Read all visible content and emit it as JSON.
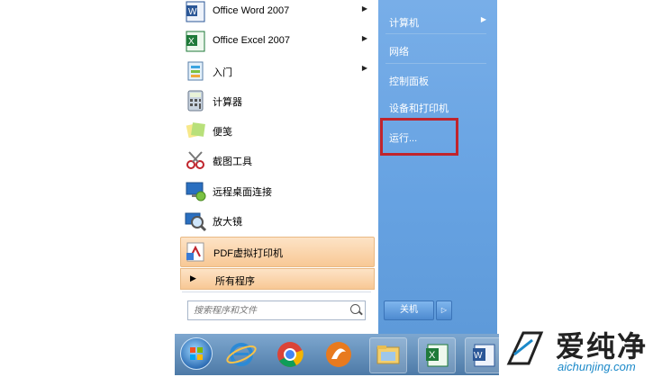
{
  "left_items": [
    {
      "label": "Office Word 2007",
      "icon": "word-icon",
      "arrow": true
    },
    {
      "label": "Office Excel 2007",
      "icon": "excel-icon",
      "arrow": true
    },
    {
      "label": "入门",
      "icon": "getting-started-icon",
      "arrow": true
    },
    {
      "label": "计算器",
      "icon": "calculator-icon",
      "arrow": false
    },
    {
      "label": "便笺",
      "icon": "sticky-notes-icon",
      "arrow": false
    },
    {
      "label": "截图工具",
      "icon": "snipping-tool-icon",
      "arrow": false
    },
    {
      "label": "远程桌面连接",
      "icon": "remote-desktop-icon",
      "arrow": false
    },
    {
      "label": "放大镜",
      "icon": "magnifier-icon",
      "arrow": false
    },
    {
      "label": "PDF虚拟打印机",
      "icon": "pdf-printer-icon",
      "arrow": false
    }
  ],
  "all_programs": "所有程序",
  "search": {
    "placeholder": "搜索程序和文件"
  },
  "right_items": [
    {
      "label": "计算机",
      "arrow": true
    },
    {
      "label": "网络",
      "arrow": false
    },
    {
      "label": "控制面板",
      "arrow": false
    },
    {
      "label": "设备和打印机",
      "arrow": false
    },
    {
      "label": "运行...",
      "arrow": false
    }
  ],
  "shutdown": {
    "label": "关机",
    "arrow": "▷"
  },
  "taskbar": [
    "windows-start-icon",
    "internet-explorer-icon",
    "chrome-icon",
    "media-app-icon",
    "file-explorer-icon",
    "excel-taskbar-icon",
    "word-taskbar-icon"
  ],
  "watermark": {
    "text": "爱纯净",
    "url": "aichunjing.com"
  },
  "colors": {
    "menu_right": "#66a2e2",
    "highlight": "#f8c895",
    "red_box": "#c0242c"
  }
}
